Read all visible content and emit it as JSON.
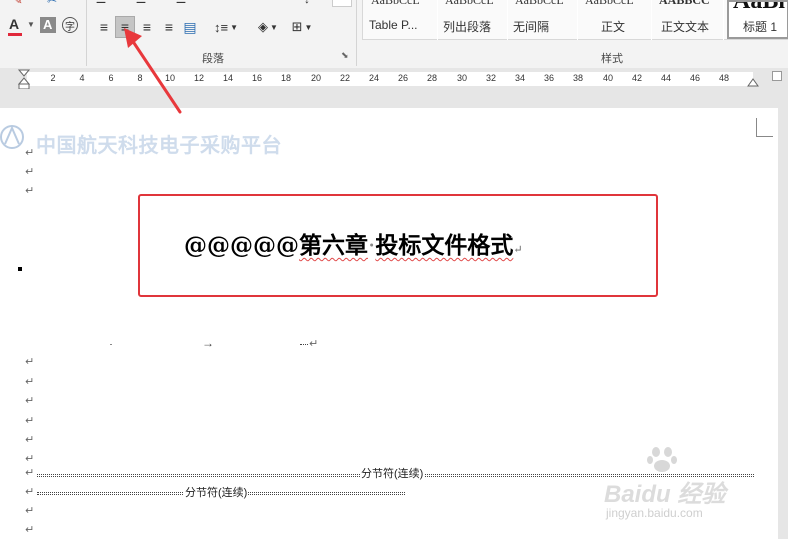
{
  "ribbon": {
    "paragraph_label": "段落",
    "styles_label": "样式",
    "font_color_letter": "A",
    "shade_letter": "A",
    "circle_char": "字",
    "styles": [
      {
        "sample": "AaBbCcL",
        "name": "Table P..."
      },
      {
        "sample": "AaBbCcL",
        "name": "列出段落"
      },
      {
        "sample": "AaBbCcL",
        "name": "无间隔"
      },
      {
        "sample": "AaBbCcL",
        "name": "正文"
      },
      {
        "sample": "AABBCC",
        "name": "正文文本"
      },
      {
        "sample": "AaBl",
        "name": "标题 1"
      }
    ]
  },
  "ruler": {
    "ticks": [
      "2",
      "4",
      "6",
      "8",
      "10",
      "12",
      "14",
      "16",
      "18",
      "20",
      "22",
      "24",
      "26",
      "28",
      "30",
      "32",
      "34",
      "36",
      "38",
      "40",
      "42",
      "44",
      "46",
      "48"
    ]
  },
  "document": {
    "watermark": "中国航天科技电子采购平台",
    "heading_prefix": "@@@@@",
    "heading_chapter": "第六章",
    "heading_dot": "·",
    "heading_title": "投标文件格式",
    "section_break_1": "分节符(连续)",
    "section_break_2": "分节符(连续)",
    "pilcrow": "↵",
    "tab_arrow": "→"
  },
  "brand": {
    "baidu_jingyan": "Baidu 经验",
    "url": "jingyan.baidu.com"
  },
  "colors": {
    "highlight_box": "#e0353b",
    "arrow": "#e8383c",
    "font_color_red": "#e0283a"
  }
}
